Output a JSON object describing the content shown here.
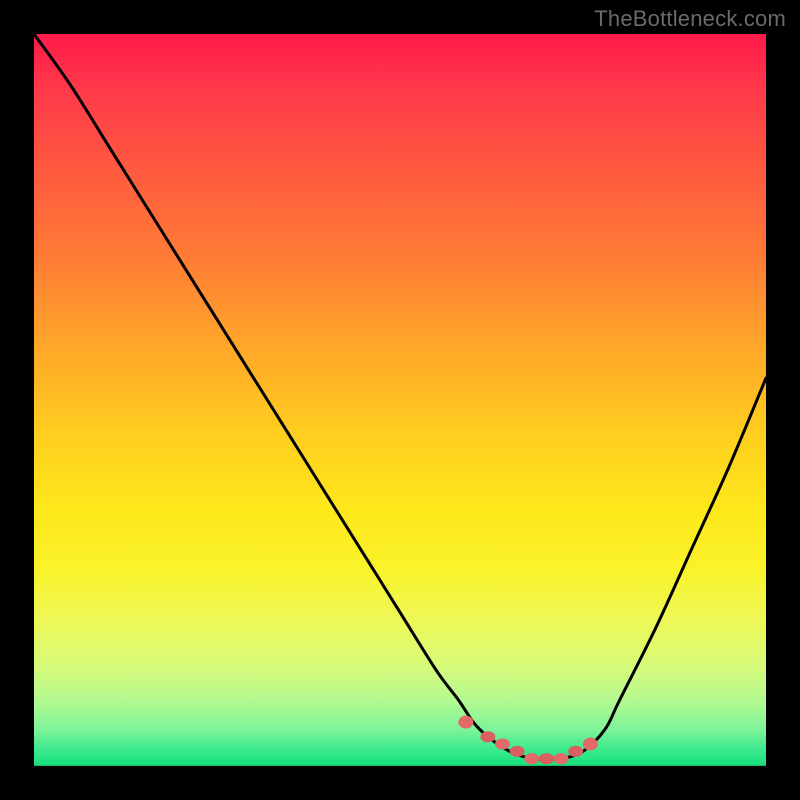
{
  "watermark": "TheBottleneck.com",
  "colors": {
    "curve_stroke": "#000000",
    "marker_fill": "#e46a6a",
    "marker_fill2": "#d86060"
  },
  "chart_data": {
    "type": "line",
    "title": "",
    "xlabel": "",
    "ylabel": "",
    "xlim": [
      0,
      100
    ],
    "ylim": [
      0,
      100
    ],
    "grid": false,
    "legend": false,
    "series": [
      {
        "name": "bottleneck-curve",
        "x": [
          0,
          5,
          10,
          15,
          20,
          25,
          30,
          35,
          40,
          45,
          50,
          55,
          58,
          60,
          62,
          65,
          68,
          70,
          72,
          75,
          78,
          80,
          85,
          90,
          95,
          100
        ],
        "values": [
          100,
          93,
          85,
          77,
          69,
          61,
          53,
          45,
          37,
          29,
          21,
          13,
          9,
          6,
          4,
          2,
          1,
          1,
          1,
          2,
          5,
          9,
          19,
          30,
          41,
          53
        ]
      }
    ],
    "markers": {
      "name": "optimal-zone",
      "x": [
        59,
        62,
        64,
        66,
        68,
        70,
        72,
        74,
        76
      ],
      "values": [
        6,
        4,
        3,
        2,
        1,
        1,
        1,
        2,
        3
      ]
    }
  }
}
